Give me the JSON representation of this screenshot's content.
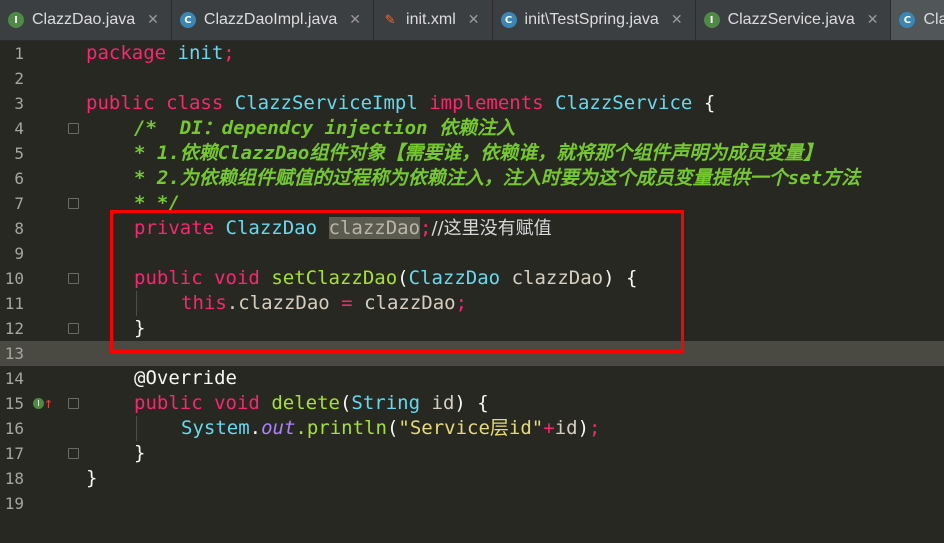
{
  "tabs": [
    {
      "label": "ClazzDao.java",
      "icon": "interface-icon",
      "badge": "I"
    },
    {
      "label": "ClazzDaoImpl.java",
      "icon": "class-icon",
      "badge": "C"
    },
    {
      "label": "init.xml",
      "icon": "xml-file-icon",
      "badge": "✎"
    },
    {
      "label": "init\\TestSpring.java",
      "icon": "spring-class-icon",
      "badge": "C"
    },
    {
      "label": "ClazzService.java",
      "icon": "interface-icon",
      "badge": "I"
    },
    {
      "label": "Claz",
      "icon": "class-icon",
      "badge": "C"
    }
  ],
  "line_numbers": [
    "1",
    "2",
    "3",
    "4",
    "5",
    "6",
    "7",
    "8",
    "9",
    "10",
    "11",
    "12",
    "13",
    "14",
    "15",
    "16",
    "17",
    "18",
    "19"
  ],
  "code": {
    "l1_kw": "package",
    "l1_name": "init",
    "l1_semi": ";",
    "l3_kw1": "public",
    "l3_kw2": "class",
    "l3_name": "ClazzServiceImpl",
    "l3_kw3": "implements",
    "l3_iface": "ClazzService",
    "l3_brace": "{",
    "l4": "/*  DI：dependcy injection 依赖注入",
    "l5": "* 1.依赖ClazzDao组件对象【需要谁，依赖谁，就将那个组件声明为成员变量】",
    "l6": "* 2.为依赖组件赋值的过程称为依赖注入，注入时要为这个成员变量提供一个set方法",
    "l7": "* */",
    "l8_kw": "private",
    "l8_type": "ClazzDao",
    "l8_field": "clazzDao",
    "l8_semi": ";",
    "l8_comment": "//这里没有赋值",
    "l10_kw1": "public",
    "l10_kw2": "void",
    "l10_fn": "setClazzDao",
    "l10_open": "(",
    "l10_type": "ClazzDao",
    "l10_param": "clazzDao",
    "l10_close": ") {",
    "l11_this": "this",
    "l11_rest": ".clazzDao",
    "l11_eq": "=",
    "l11_val": "clazzDao",
    "l11_semi": ";",
    "l12": "}",
    "l14": "@Override",
    "l15_kw1": "public",
    "l15_kw2": "void",
    "l15_fn": "delete",
    "l15_open": "(",
    "l15_type": "String",
    "l15_param": "id",
    "l15_close": ") {",
    "l16_sys": "System",
    "l16_dot": ".",
    "l16_out": "out",
    "l16_fn": ".println",
    "l16_open": "(",
    "l16_str": "\"Service层id\"",
    "l16_plus": "+",
    "l16_id": "id",
    "l16_close": ")",
    "l16_semi": ";",
    "l17": "}",
    "l18": "}"
  },
  "colors": {
    "keyword": "#f92672",
    "type": "#66d9ef",
    "function": "#a6e22e",
    "comment": "#75c92e",
    "highlight_box": "#ff0000"
  },
  "gutter_markers": {
    "l15": "implements-method-icon"
  }
}
